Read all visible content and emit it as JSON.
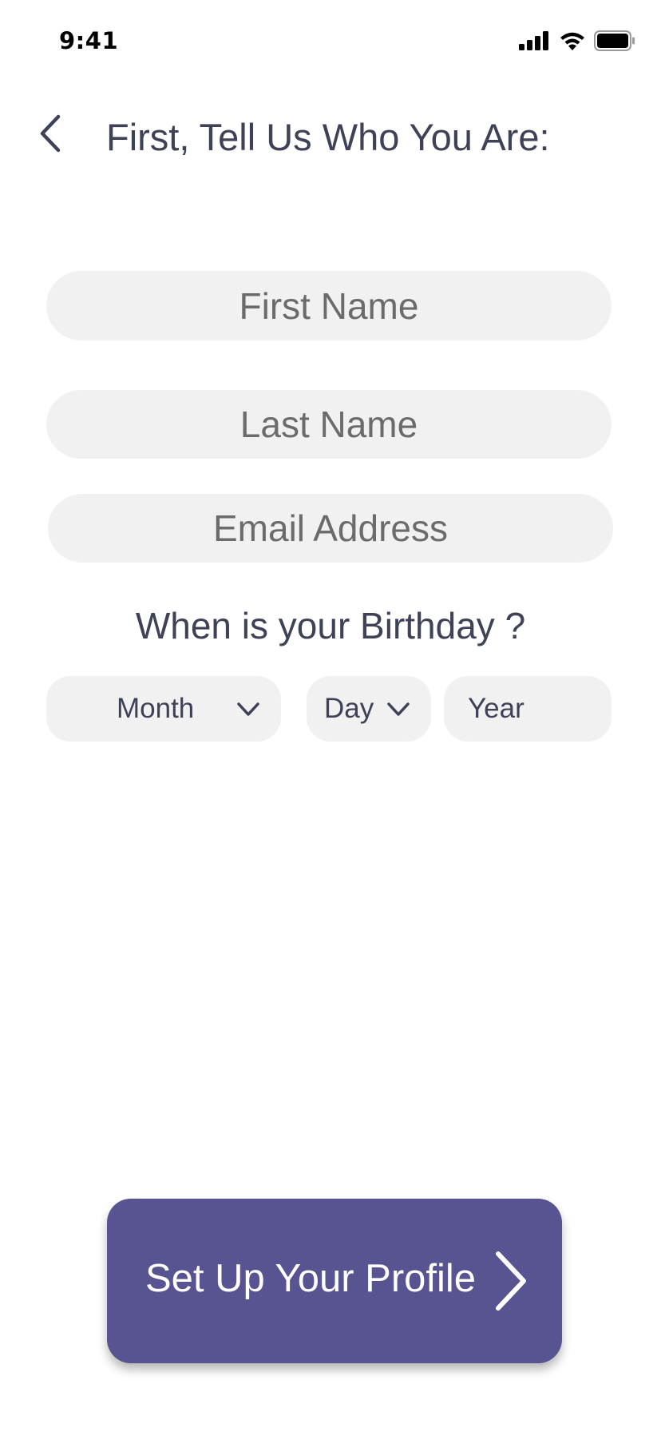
{
  "status_bar": {
    "time": "9:41",
    "icons": [
      "cellular-signal-icon",
      "wifi-icon",
      "battery-icon"
    ]
  },
  "header": {
    "back_icon": "chevron-left-icon",
    "title": "First, Tell Us Who You Are:"
  },
  "form": {
    "first_name_placeholder": "First Name",
    "first_name_value": "",
    "last_name_placeholder": "Last Name",
    "last_name_value": "",
    "email_placeholder": "Email Address",
    "email_value": "",
    "birthday_question": "When is your Birthday ?",
    "month_label": "Month",
    "day_label": "Day",
    "year_label": "Year"
  },
  "cta": {
    "label": "Set Up Your Profile",
    "icon": "chevron-right-icon"
  },
  "colors": {
    "primary": "#585391",
    "field_bg": "#f1f1f1",
    "text_dark": "#3f4257",
    "placeholder": "#6b6b6b"
  }
}
